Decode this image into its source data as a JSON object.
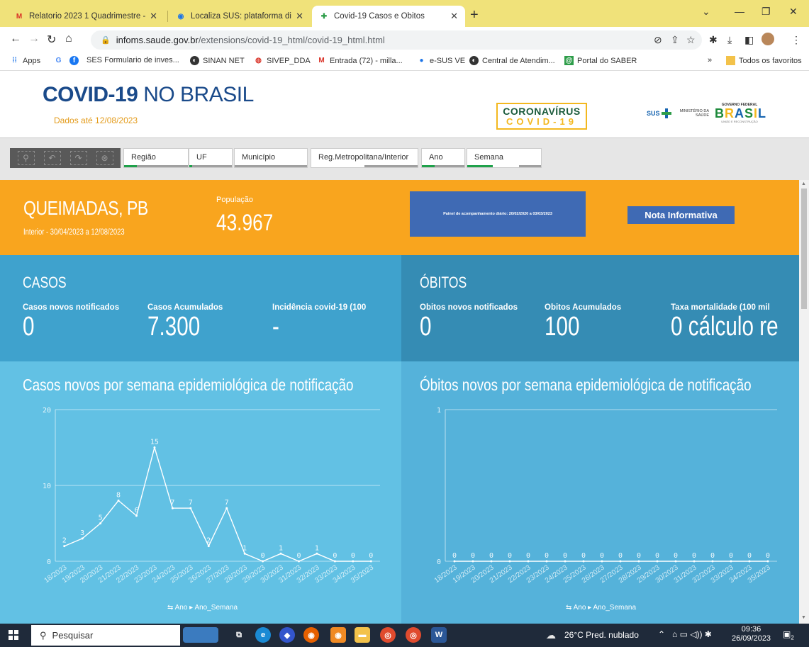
{
  "browser": {
    "tabs": [
      {
        "title": "Relatorio 2023 1 Quadrimestre -",
        "active": false
      },
      {
        "title": "Localiza SUS: plataforma dispon",
        "active": false
      },
      {
        "title": "Covid-19 Casos e Óbitos",
        "active": true
      }
    ],
    "url_domain": "infoms.saude.gov.br",
    "url_path": "/extensions/covid-19_html/covid-19_html.html",
    "bookmarks": [
      "Apps",
      "SES Formulario de inves...",
      "SINAN NET",
      "SIVEP_DDA",
      "Entrada (72) - milla...",
      "e-SUS VE",
      "Central de Atendim...",
      "Portal do SABER"
    ],
    "bookmarks_more": "»",
    "all_favorites": "Todos os favoritos"
  },
  "header": {
    "title_bold": "COVID-19",
    "title_thin": " NO BRASIL",
    "date": "Dados até 12/08/2023",
    "logo_line1": "CORONAVÍRUS",
    "logo_line2": "COVID-19",
    "sus": "SUS",
    "ministerio": "MINISTÉRIO DA SAÚDE",
    "gov": "GOVERNO FEDERAL",
    "brasil": "BRASIL",
    "gov_sub": "UNIÃO E RECONSTRUÇÃO"
  },
  "filters": [
    "Região",
    "UF",
    "Município",
    "Reg.Metropolitana/Interior",
    "Ano",
    "Semana"
  ],
  "location": {
    "name": "QUEIMADAS, PB",
    "range": "Interior - 30/04/2023 a 12/08/2023",
    "population_label": "População",
    "population_value": "43.967",
    "painel_text": "Painel de acompanhamento diário: 20/02/2020 a 03/03/2023",
    "nota_label": "Nota Informativa"
  },
  "casos": {
    "title": "CASOS",
    "novos_label": "Casos novos notificados",
    "novos_value": "0",
    "acum_label": "Casos Acumulados",
    "acum_value": "7.300",
    "incid_label": "Incidência covid-19 (100",
    "incid_value": "-"
  },
  "obitos": {
    "title": "ÓBITOS",
    "novos_label": "Óbitos novos notificados",
    "novos_value": "0",
    "acum_label": "Óbitos Acumulados",
    "acum_value": "100",
    "taxa_label": "Taxa mortalidade (100 mil",
    "taxa_value": "0 cálculo re"
  },
  "chart_data": [
    {
      "type": "line",
      "title": "Casos novos por semana epidemiológica de notificação",
      "x": [
        "18/2023",
        "19/2023",
        "20/2023",
        "21/2023",
        "22/2023",
        "23/2023",
        "24/2023",
        "25/2023",
        "26/2023",
        "27/2023",
        "28/2023",
        "29/2023",
        "30/2023",
        "31/2023",
        "32/2023",
        "33/2023",
        "34/2023",
        "35/2023"
      ],
      "values": [
        2,
        3,
        5,
        8,
        6,
        15,
        7,
        7,
        2,
        7,
        1,
        0,
        1,
        0,
        1,
        0,
        0,
        0
      ],
      "yticks": [
        "0",
        "10",
        "20"
      ],
      "ylim": [
        0,
        20
      ],
      "footer_dim1": "Ano",
      "footer_dim2": "Ano_Semana"
    },
    {
      "type": "line",
      "title": "Óbitos novos por semana epidemiológica de notificação",
      "x": [
        "18/2023",
        "19/2023",
        "20/2023",
        "21/2023",
        "22/2023",
        "23/2023",
        "24/2023",
        "25/2023",
        "26/2023",
        "27/2023",
        "28/2023",
        "29/2023",
        "30/2023",
        "31/2023",
        "32/2023",
        "33/2023",
        "34/2023",
        "35/2023"
      ],
      "values": [
        0,
        0,
        0,
        0,
        0,
        0,
        0,
        0,
        0,
        0,
        0,
        0,
        0,
        0,
        0,
        0,
        0,
        0
      ],
      "yticks": [
        "0",
        "1"
      ],
      "ylim": [
        0,
        1
      ],
      "footer_dim1": "Ano",
      "footer_dim2": "Ano_Semana"
    }
  ],
  "taskbar": {
    "search": "Pesquisar",
    "weather": "26°C Pred. nublado",
    "time": "09:36",
    "date": "26/09/2023",
    "notif": "2"
  }
}
